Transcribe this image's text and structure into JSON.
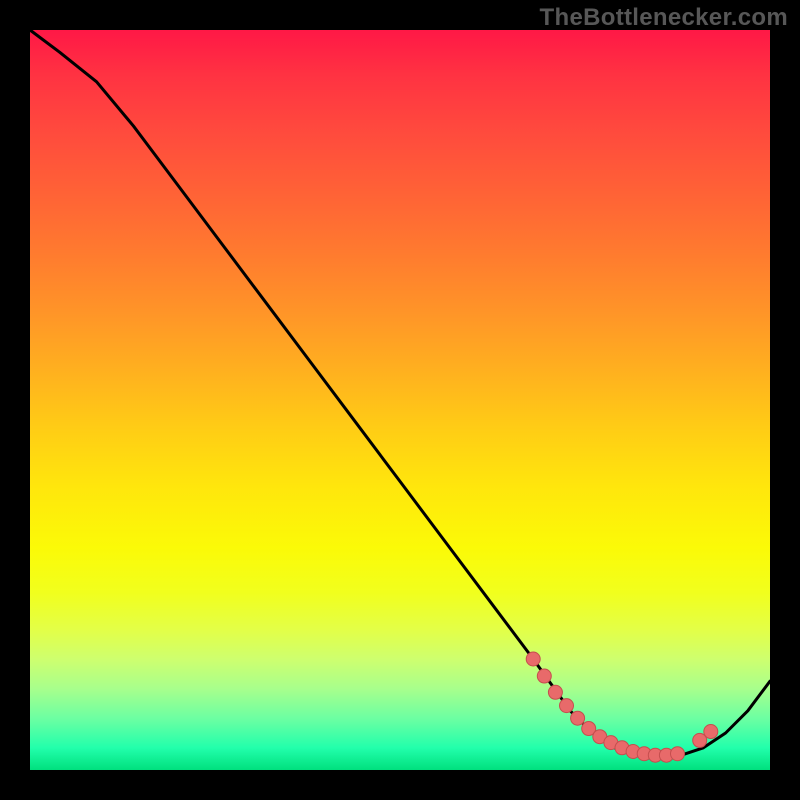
{
  "watermark": "TheBottlenecker.com",
  "colors": {
    "page_bg": "#000000",
    "curve": "#000000",
    "marker_fill": "#e86a6a",
    "marker_stroke": "#c54e4e"
  },
  "chart_data": {
    "type": "line",
    "title": "",
    "xlabel": "",
    "ylabel": "",
    "xlim": [
      0,
      1
    ],
    "ylim": [
      0,
      1
    ],
    "grid": false,
    "legend": false,
    "x": [
      0.0,
      0.04,
      0.09,
      0.14,
      0.2,
      0.26,
      0.32,
      0.38,
      0.44,
      0.5,
      0.56,
      0.62,
      0.68,
      0.73,
      0.76,
      0.79,
      0.82,
      0.85,
      0.88,
      0.91,
      0.94,
      0.97,
      1.0
    ],
    "y": [
      1.0,
      0.97,
      0.93,
      0.87,
      0.79,
      0.71,
      0.63,
      0.55,
      0.47,
      0.39,
      0.31,
      0.23,
      0.15,
      0.08,
      0.05,
      0.03,
      0.02,
      0.02,
      0.02,
      0.03,
      0.05,
      0.08,
      0.12
    ],
    "markers": {
      "x": [
        0.68,
        0.695,
        0.71,
        0.725,
        0.74,
        0.755,
        0.77,
        0.785,
        0.8,
        0.815,
        0.83,
        0.845,
        0.86,
        0.875,
        0.905,
        0.92
      ],
      "y": [
        0.15,
        0.127,
        0.105,
        0.087,
        0.07,
        0.056,
        0.045,
        0.037,
        0.03,
        0.025,
        0.022,
        0.02,
        0.02,
        0.022,
        0.04,
        0.052
      ]
    }
  }
}
